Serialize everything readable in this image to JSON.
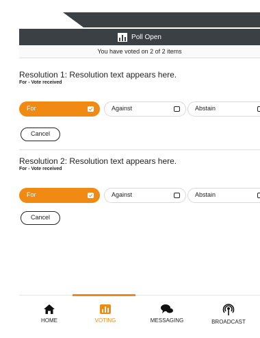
{
  "header": {
    "title": "Poll Open"
  },
  "status": {
    "text": "You have voted on 2 of 2 items"
  },
  "resolutions": [
    {
      "title": "Resolution 1: Resolution text appears here.",
      "subtitle": "For - Vote received",
      "options": [
        "For",
        "Against",
        "Abstain"
      ],
      "selected": "For",
      "cancel_label": "Cancel"
    },
    {
      "title": "Resolution 2: Resolution text appears here.",
      "subtitle": "For - Vote received",
      "options": [
        "For",
        "Against",
        "Abstain"
      ],
      "selected": "For",
      "cancel_label": "Cancel"
    }
  ],
  "nav": {
    "items": [
      {
        "label": "HOME",
        "icon": "home-icon"
      },
      {
        "label": "VOTING",
        "icon": "voting-icon"
      },
      {
        "label": "MESSAGING",
        "icon": "messaging-icon"
      },
      {
        "label": "BROADCAST",
        "icon": "broadcast-icon"
      }
    ],
    "active": "VOTING"
  },
  "colors": {
    "accent": "#f08a12",
    "header_bg": "#3b4044"
  }
}
